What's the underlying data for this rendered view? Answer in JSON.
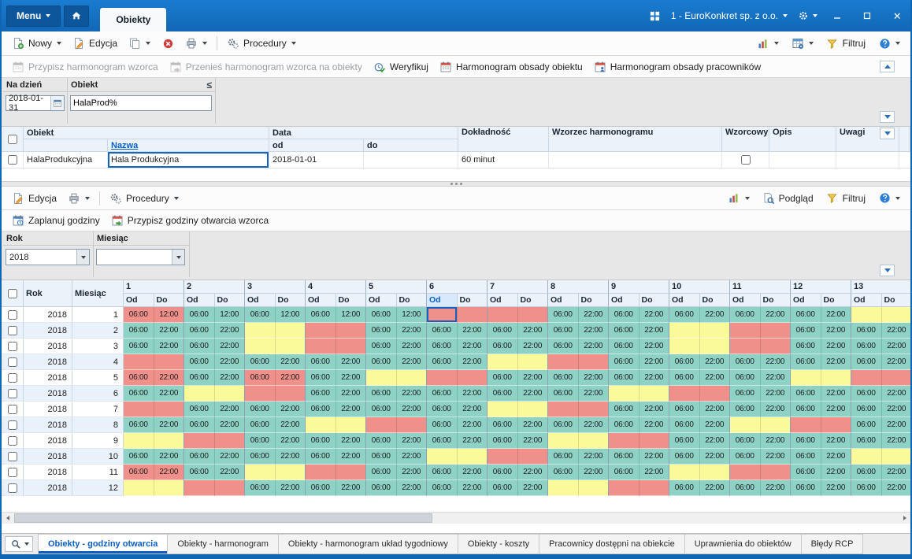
{
  "titlebar": {
    "menu": "Menu",
    "tab": "Obiekty",
    "company": "1 - EuroKonkret sp. z o.o."
  },
  "toolbar_main": {
    "nowy": "Nowy",
    "edycja": "Edycja",
    "procedury": "Procedury",
    "filtruj": "Filtruj"
  },
  "actions": {
    "przypisz_wzorzec": "Przypisz harmonogram wzorca",
    "przenies_wzorzec": "Przenieś harmonogram wzorca na obiekty",
    "weryfikuj": "Weryfikuj",
    "harmonogram_obiektu": "Harmonogram obsady obiektu",
    "harmonogram_pracownikow": "Harmonogram obsady pracowników"
  },
  "filter1": {
    "na_dzien_label": "Na dzień",
    "na_dzien_value": "2018-01-31",
    "obiekt_label": "Obiekt",
    "obiekt_value": "HalaProd%",
    "operator": "≤"
  },
  "objects_table": {
    "headers": {
      "obiekt": "Obiekt",
      "nazwa": "Nazwa",
      "data": "Data",
      "od": "od",
      "do": "do",
      "dokladnosc": "Dokładność",
      "wzorzec": "Wzorzec harmonogramu",
      "wzorcowy": "Wzorcowy",
      "opis": "Opis",
      "uwagi": "Uwagi"
    },
    "row": {
      "obiekt": "HalaProdukcyjna",
      "nazwa": "Hala Produkcyjna",
      "data_od": "2018-01-01",
      "data_do": "",
      "dokladnosc": "60 minut",
      "wzorzec": "",
      "wzorcowy": false,
      "opis": "",
      "uwagi": ""
    }
  },
  "toolbar_hours": {
    "edycja": "Edycja",
    "procedury": "Procedury",
    "podglad": "Podgląd",
    "filtruj": "Filtruj"
  },
  "hours_actions": {
    "zaplanuj": "Zaplanuj godziny",
    "przypisz": "Przypisz godziny otwarcia wzorca"
  },
  "filter2": {
    "rok_label": "Rok",
    "rok_value": "2018",
    "miesiac_label": "Miesiąc",
    "miesiac_value": ""
  },
  "hours_table": {
    "rok_header": "Rok",
    "miesiac_header": "Miesiąc",
    "od_header": "Od",
    "do_header": "Do",
    "days": [
      1,
      2,
      3,
      4,
      5,
      6,
      7,
      8,
      9,
      10,
      11,
      12,
      13
    ],
    "selected": {
      "row": 0,
      "day_index": 5,
      "part": "od"
    },
    "cell_colors": {
      "t": "#8ed1c5",
      "y": "#fbfa9a",
      "r": "#f0908a"
    },
    "rows": [
      {
        "rok": "2018",
        "miesiac": "1",
        "cells": [
          [
            "r",
            "06:00",
            "12:00"
          ],
          [
            "t",
            "06:00",
            "12:00"
          ],
          [
            "t",
            "06:00",
            "12:00"
          ],
          [
            "t",
            "06:00",
            "12:00"
          ],
          [
            "t",
            "06:00",
            "12:00"
          ],
          [
            "r"
          ],
          [
            "r"
          ],
          [
            "t",
            "06:00",
            "22:00"
          ],
          [
            "t",
            "06:00",
            "22:00"
          ],
          [
            "t",
            "06:00",
            "22:00"
          ],
          [
            "t",
            "06:00",
            "22:00"
          ],
          [
            "t",
            "06:00",
            "22:00"
          ],
          [
            "y"
          ]
        ]
      },
      {
        "rok": "2018",
        "miesiac": "2",
        "cells": [
          [
            "t",
            "06:00",
            "22:00"
          ],
          [
            "t",
            "06:00",
            "22:00"
          ],
          [
            "y"
          ],
          [
            "r"
          ],
          [
            "t",
            "06:00",
            "22:00"
          ],
          [
            "t",
            "06:00",
            "22:00"
          ],
          [
            "t",
            "06:00",
            "22:00"
          ],
          [
            "t",
            "06:00",
            "22:00"
          ],
          [
            "t",
            "06:00",
            "22:00"
          ],
          [
            "y"
          ],
          [
            "r"
          ],
          [
            "t",
            "06:00",
            "22:00"
          ],
          [
            "t",
            "06:00",
            "22:00"
          ]
        ]
      },
      {
        "rok": "2018",
        "miesiac": "3",
        "cells": [
          [
            "t",
            "06:00",
            "22:00"
          ],
          [
            "t",
            "06:00",
            "22:00"
          ],
          [
            "y"
          ],
          [
            "r"
          ],
          [
            "t",
            "06:00",
            "22:00"
          ],
          [
            "t",
            "06:00",
            "22:00"
          ],
          [
            "t",
            "06:00",
            "22:00"
          ],
          [
            "t",
            "06:00",
            "22:00"
          ],
          [
            "t",
            "06:00",
            "22:00"
          ],
          [
            "y"
          ],
          [
            "r"
          ],
          [
            "t",
            "06:00",
            "22:00"
          ],
          [
            "t",
            "06:00",
            "22:00"
          ]
        ]
      },
      {
        "rok": "2018",
        "miesiac": "4",
        "cells": [
          [
            "r"
          ],
          [
            "t",
            "06:00",
            "22:00"
          ],
          [
            "t",
            "06:00",
            "22:00"
          ],
          [
            "t",
            "06:00",
            "22:00"
          ],
          [
            "t",
            "06:00",
            "22:00"
          ],
          [
            "t",
            "06:00",
            "22:00"
          ],
          [
            "y"
          ],
          [
            "r"
          ],
          [
            "t",
            "06:00",
            "22:00"
          ],
          [
            "t",
            "06:00",
            "22:00"
          ],
          [
            "t",
            "06:00",
            "22:00"
          ],
          [
            "t",
            "06:00",
            "22:00"
          ],
          [
            "t",
            "06:00",
            "22:00"
          ]
        ]
      },
      {
        "rok": "2018",
        "miesiac": "5",
        "cells": [
          [
            "r",
            "06:00",
            "22:00"
          ],
          [
            "t",
            "06:00",
            "22:00"
          ],
          [
            "r",
            "06:00",
            "22:00"
          ],
          [
            "t",
            "06:00",
            "22:00"
          ],
          [
            "y"
          ],
          [
            "r"
          ],
          [
            "t",
            "06:00",
            "22:00"
          ],
          [
            "t",
            "06:00",
            "22:00"
          ],
          [
            "t",
            "06:00",
            "22:00"
          ],
          [
            "t",
            "06:00",
            "22:00"
          ],
          [
            "t",
            "06:00",
            "22:00"
          ],
          [
            "y"
          ],
          [
            "r"
          ]
        ]
      },
      {
        "rok": "2018",
        "miesiac": "6",
        "cells": [
          [
            "t",
            "06:00",
            "22:00"
          ],
          [
            "y"
          ],
          [
            "r"
          ],
          [
            "t",
            "06:00",
            "22:00"
          ],
          [
            "t",
            "06:00",
            "22:00"
          ],
          [
            "t",
            "06:00",
            "22:00"
          ],
          [
            "t",
            "06:00",
            "22:00"
          ],
          [
            "t",
            "06:00",
            "22:00"
          ],
          [
            "y"
          ],
          [
            "r"
          ],
          [
            "t",
            "06:00",
            "22:00"
          ],
          [
            "t",
            "06:00",
            "22:00"
          ],
          [
            "t",
            "06:00",
            "22:00"
          ]
        ]
      },
      {
        "rok": "2018",
        "miesiac": "7",
        "cells": [
          [
            "r"
          ],
          [
            "t",
            "06:00",
            "22:00"
          ],
          [
            "t",
            "06:00",
            "22:00"
          ],
          [
            "t",
            "06:00",
            "22:00"
          ],
          [
            "t",
            "06:00",
            "22:00"
          ],
          [
            "t",
            "06:00",
            "22:00"
          ],
          [
            "y"
          ],
          [
            "r"
          ],
          [
            "t",
            "06:00",
            "22:00"
          ],
          [
            "t",
            "06:00",
            "22:00"
          ],
          [
            "t",
            "06:00",
            "22:00"
          ],
          [
            "t",
            "06:00",
            "22:00"
          ],
          [
            "t",
            "06:00",
            "22:00"
          ]
        ]
      },
      {
        "rok": "2018",
        "miesiac": "8",
        "cells": [
          [
            "t",
            "06:00",
            "22:00"
          ],
          [
            "t",
            "06:00",
            "22:00"
          ],
          [
            "t",
            "06:00",
            "22:00"
          ],
          [
            "y"
          ],
          [
            "r"
          ],
          [
            "t",
            "06:00",
            "22:00"
          ],
          [
            "t",
            "06:00",
            "22:00"
          ],
          [
            "t",
            "06:00",
            "22:00"
          ],
          [
            "t",
            "06:00",
            "22:00"
          ],
          [
            "t",
            "06:00",
            "22:00"
          ],
          [
            "y"
          ],
          [
            "r"
          ],
          [
            "t",
            "06:00",
            "22:00"
          ]
        ]
      },
      {
        "rok": "2018",
        "miesiac": "9",
        "cells": [
          [
            "y"
          ],
          [
            "r"
          ],
          [
            "t",
            "06:00",
            "22:00"
          ],
          [
            "t",
            "06:00",
            "22:00"
          ],
          [
            "t",
            "06:00",
            "22:00"
          ],
          [
            "t",
            "06:00",
            "22:00"
          ],
          [
            "t",
            "06:00",
            "22:00"
          ],
          [
            "y"
          ],
          [
            "r"
          ],
          [
            "t",
            "06:00",
            "22:00"
          ],
          [
            "t",
            "06:00",
            "22:00"
          ],
          [
            "t",
            "06:00",
            "22:00"
          ],
          [
            "t",
            "06:00",
            "22:00"
          ]
        ]
      },
      {
        "rok": "2018",
        "miesiac": "10",
        "cells": [
          [
            "t",
            "06:00",
            "22:00"
          ],
          [
            "t",
            "06:00",
            "22:00"
          ],
          [
            "t",
            "06:00",
            "22:00"
          ],
          [
            "t",
            "06:00",
            "22:00"
          ],
          [
            "t",
            "06:00",
            "22:00"
          ],
          [
            "y"
          ],
          [
            "r"
          ],
          [
            "t",
            "06:00",
            "22:00"
          ],
          [
            "t",
            "06:00",
            "22:00"
          ],
          [
            "t",
            "06:00",
            "22:00"
          ],
          [
            "t",
            "06:00",
            "22:00"
          ],
          [
            "t",
            "06:00",
            "22:00"
          ],
          [
            "y"
          ]
        ]
      },
      {
        "rok": "2018",
        "miesiac": "11",
        "cells": [
          [
            "r",
            "06:00",
            "22:00"
          ],
          [
            "t",
            "06:00",
            "22:00"
          ],
          [
            "y"
          ],
          [
            "r"
          ],
          [
            "t",
            "06:00",
            "22:00"
          ],
          [
            "t",
            "06:00",
            "22:00"
          ],
          [
            "t",
            "06:00",
            "22:00"
          ],
          [
            "t",
            "06:00",
            "22:00"
          ],
          [
            "t",
            "06:00",
            "22:00"
          ],
          [
            "y"
          ],
          [
            "r"
          ],
          [
            "t",
            "06:00",
            "22:00"
          ],
          [
            "t",
            "06:00",
            "22:00"
          ]
        ]
      },
      {
        "rok": "2018",
        "miesiac": "12",
        "cells": [
          [
            "y"
          ],
          [
            "r"
          ],
          [
            "t",
            "06:00",
            "22:00"
          ],
          [
            "t",
            "06:00",
            "22:00"
          ],
          [
            "t",
            "06:00",
            "22:00"
          ],
          [
            "t",
            "06:00",
            "22:00"
          ],
          [
            "t",
            "06:00",
            "22:00"
          ],
          [
            "y"
          ],
          [
            "r"
          ],
          [
            "t",
            "06:00",
            "22:00"
          ],
          [
            "t",
            "06:00",
            "22:00"
          ],
          [
            "t",
            "06:00",
            "22:00"
          ],
          [
            "t",
            "06:00",
            "22:00"
          ]
        ]
      }
    ]
  },
  "bottom_tabs": {
    "active_index": 0,
    "tabs": [
      "Obiekty - godziny otwarcia",
      "Obiekty - harmonogram",
      "Obiekty - harmonogram układ tygodniowy",
      "Obiekty - koszty",
      "Pracownicy dostępni na obiekcie",
      "Uprawnienia do obiektów",
      "Błędy RCP"
    ]
  },
  "colors": {
    "titlebar": "#1470bf",
    "accent": "#0b5fc4",
    "workday_cell": "#8ed1c5",
    "saturday_cell": "#fbfa9a",
    "holiday_cell": "#f0908a"
  }
}
